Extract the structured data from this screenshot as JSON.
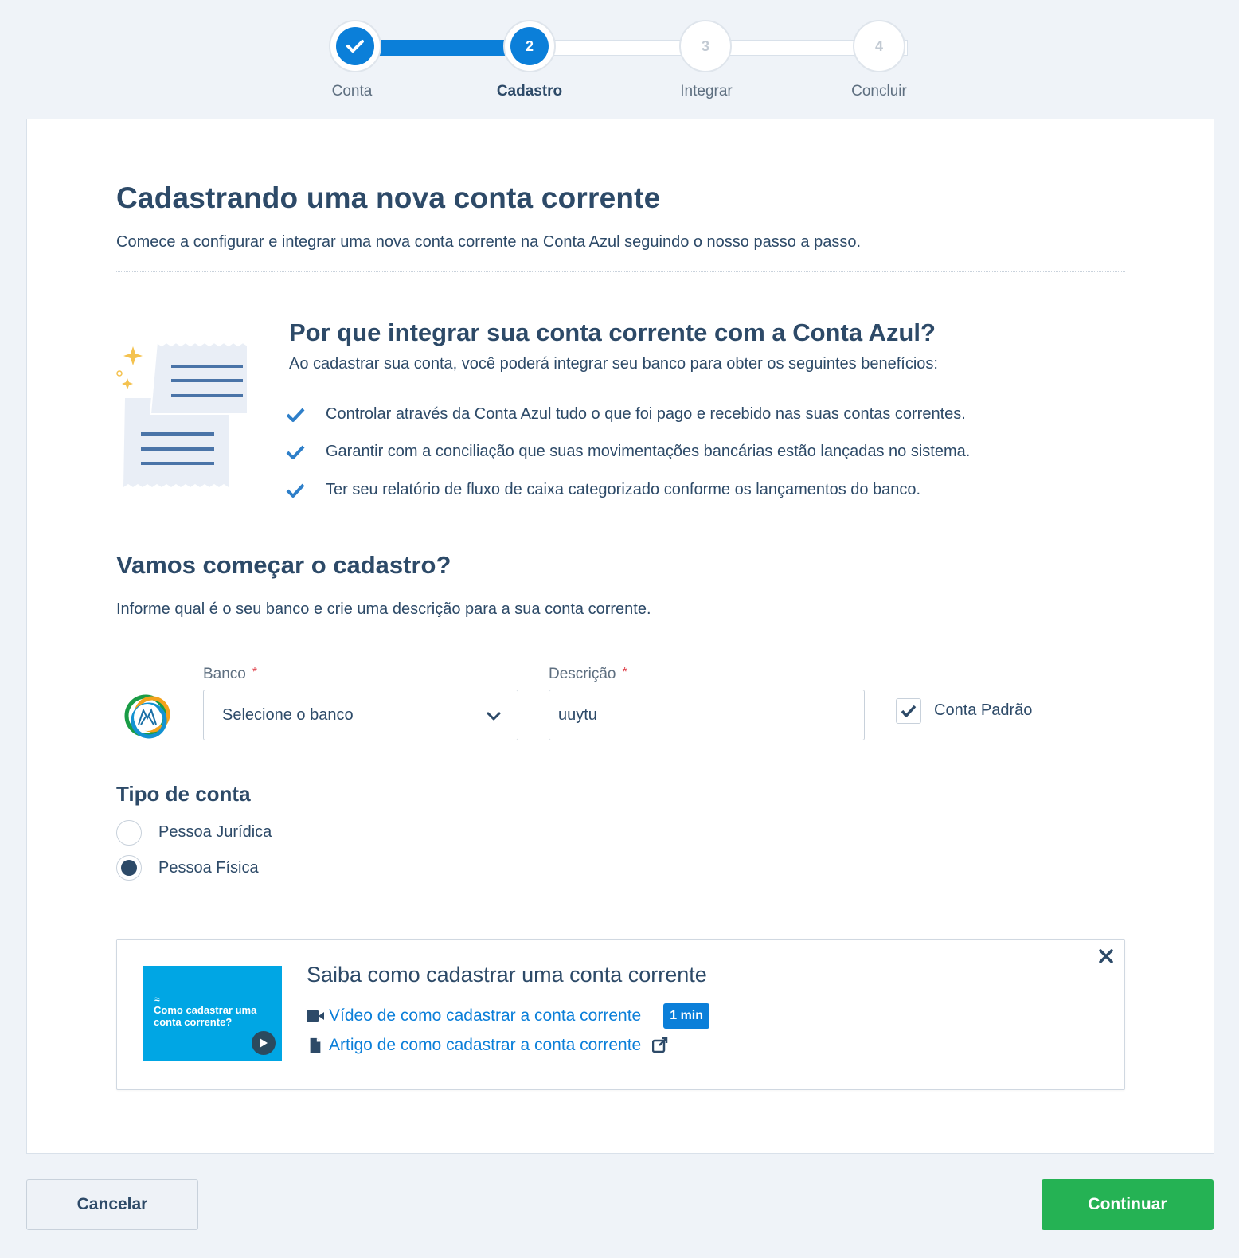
{
  "stepper": {
    "steps": [
      {
        "number": "",
        "label": "Conta",
        "state": "done"
      },
      {
        "number": "2",
        "label": "Cadastro",
        "state": "current"
      },
      {
        "number": "3",
        "label": "Integrar",
        "state": "pending"
      },
      {
        "number": "4",
        "label": "Concluir",
        "state": "pending"
      }
    ]
  },
  "header": {
    "title": "Cadastrando uma nova conta corrente",
    "subtitle": "Comece a configurar e integrar uma nova conta corrente na Conta Azul seguindo o nosso passo a passo."
  },
  "why": {
    "title": "Por que integrar sua conta corrente com a Conta Azul?",
    "subtitle": "Ao cadastrar sua conta, você poderá integrar seu banco para obter os seguintes benefícios:",
    "benefits": [
      "Controlar através da Conta Azul tudo o que foi pago e recebido nas suas contas correntes.",
      "Garantir com a conciliação que suas movimentações bancárias estão lançadas no sistema.",
      "Ter seu relatório de fluxo de caixa categorizado conforme os lançamentos do banco."
    ]
  },
  "form": {
    "title": "Vamos começar o cadastro?",
    "subtitle": "Informe qual é o seu banco e crie uma descrição para a sua conta corrente.",
    "bank_label": "Banco",
    "bank_placeholder": "Selecione o banco",
    "description_label": "Descrição",
    "description_value": "uuytu",
    "required_mark": "*",
    "default_account_label": "Conta Padrão",
    "default_account_checked": true,
    "account_type_title": "Tipo de conta",
    "account_types": [
      "Pessoa Jurídica",
      "Pessoa Física"
    ],
    "selected_account_type": "Pessoa Física"
  },
  "help": {
    "thumbnail_text": "Como cadastrar uma conta corrente?",
    "title": "Saiba como cadastrar uma conta corrente",
    "video_link": "Vídeo de como cadastrar a conta corrente",
    "video_duration": "1 min",
    "article_link": "Artigo de como cadastrar a conta corrente"
  },
  "footer": {
    "cancel_label": "Cancelar",
    "continue_label": "Continuar"
  },
  "colors": {
    "primary": "#0b7fd9",
    "text": "#2d4a68",
    "success": "#25b254",
    "thumbnail": "#00a6e4"
  }
}
